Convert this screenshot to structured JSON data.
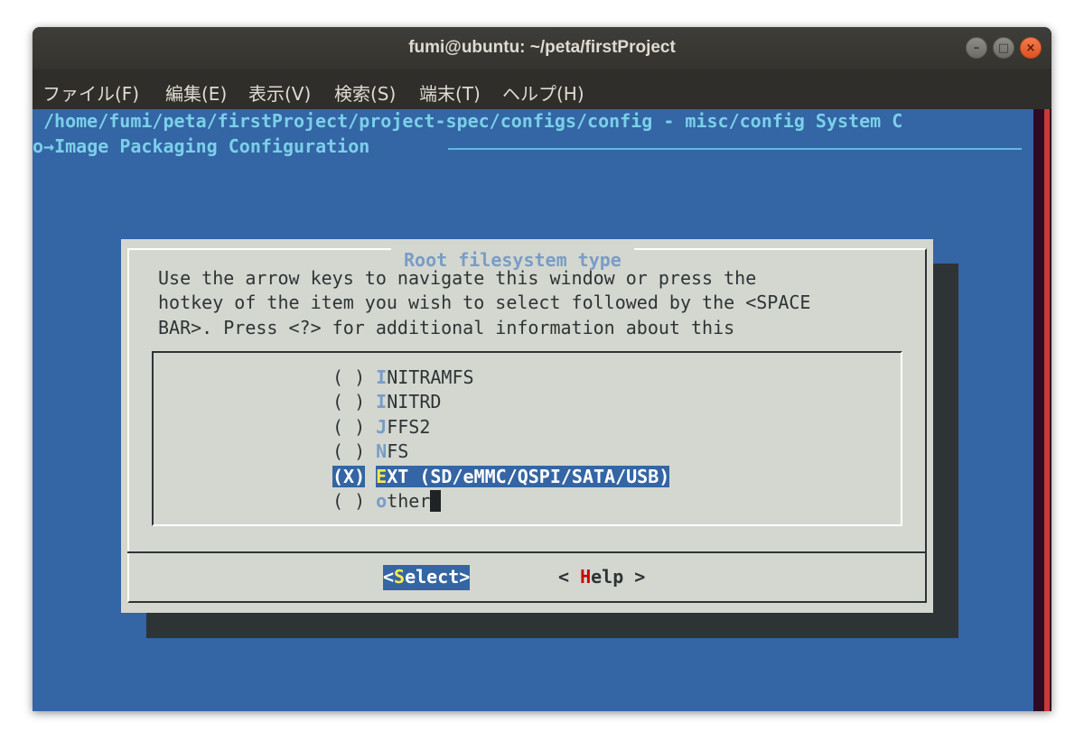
{
  "window": {
    "title": "fumi@ubuntu: ~/peta/firstProject",
    "min_icon": "minimize-icon",
    "max_icon": "maximize-icon",
    "close_icon": "close-icon"
  },
  "menubar": {
    "items": [
      "ファイル(F)",
      "編集(E)",
      "表示(V)",
      "検索(S)",
      "端末(T)",
      "ヘルプ(H)"
    ]
  },
  "terminal": {
    "path_line1": "/home/fumi/peta/firstProject/project-spec/configs/config - misc/config System C",
    "path_line2": "o→Image Packaging Configuration",
    "colors": {
      "background": "#3465a4",
      "accent": "#7ad0e8",
      "dialog": "#d3d7cf",
      "highlight": "#3465a4"
    }
  },
  "dialog": {
    "title": "Root filesystem type",
    "help": [
      "Use the arrow keys to navigate this window or press the",
      "hotkey of the item you wish to select followed by the <SPACE",
      "BAR>. Press <?> for additional information about this"
    ],
    "options": [
      {
        "mark": "( )",
        "hotkey": "I",
        "rest": "NITRAMFS"
      },
      {
        "mark": "( )",
        "hotkey": "I",
        "rest": "NITRD"
      },
      {
        "mark": "( )",
        "hotkey": "J",
        "rest": "FFS2"
      },
      {
        "mark": "( )",
        "hotkey": "N",
        "rest": "FS"
      },
      {
        "mark": "(X)",
        "hotkey": "E",
        "rest": "XT (SD/eMMC/QSPI/SATA/USB)"
      },
      {
        "mark": "( )",
        "hotkey": "o",
        "rest": "ther"
      }
    ],
    "buttons": {
      "select_pre": "<",
      "select_hk": "S",
      "select_rest": "elect>",
      "help_pre": "< ",
      "help_hk": "H",
      "help_rest": "elp >"
    }
  }
}
